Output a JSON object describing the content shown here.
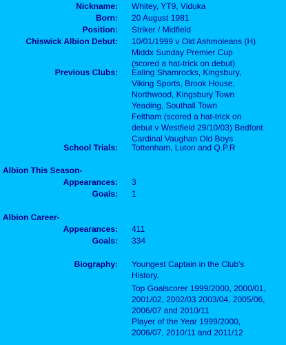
{
  "profile": {
    "nickname_label": "Nickname:",
    "nickname": "Whitey, YT9, Viduka",
    "born_label": "Born:",
    "born": "20 August 1981",
    "position_label": "Position:",
    "position": "Striker / Midfield",
    "debut_label": "Chiswick Albion Debut:",
    "debut": [
      "10/01/1999 v Old Ashmoleans (H)",
      "Middx Sunday Premier Cup",
      "(scored a hat-trick on debut)"
    ],
    "previous_clubs_label": "Previous Clubs:",
    "previous_clubs": [
      "Ealing Shamrocks, Kingsbury,",
      "Viking Sports, Brook House,",
      "Northwood, Kingsbury Town",
      "Yeading, Southall Town",
      "Feltham (scored a hat-trick on",
      "debut v Westfield 29/10/03) Bedfont",
      "Cardinal Vaughan Old Boys"
    ],
    "school_trials_label": "School Trials:",
    "school_trials": "Tottenham, Luton and Q.P.R"
  },
  "this_season": {
    "title": "Albion This Season-",
    "appearances_label": "Appearances:",
    "appearances": "3",
    "goals_label": "Goals:",
    "goals": "1"
  },
  "career": {
    "title": "Albion Career-",
    "appearances_label": "Appearances:",
    "appearances": "411",
    "goals_label": "Goals:",
    "goals": "334"
  },
  "biography": {
    "label": "Biography:",
    "para1": [
      "Youngest Captain in the Club's",
      "History."
    ],
    "para2": [
      "Top Goalscorer 1999/2000, 2000/01,",
      "2001/02, 2002/03 2003/04, 2005/06,",
      "2006/07 and 2010/11",
      "Player of the Year 1999/2000,",
      "2006/07, 2010/11 and 2011/12"
    ]
  }
}
